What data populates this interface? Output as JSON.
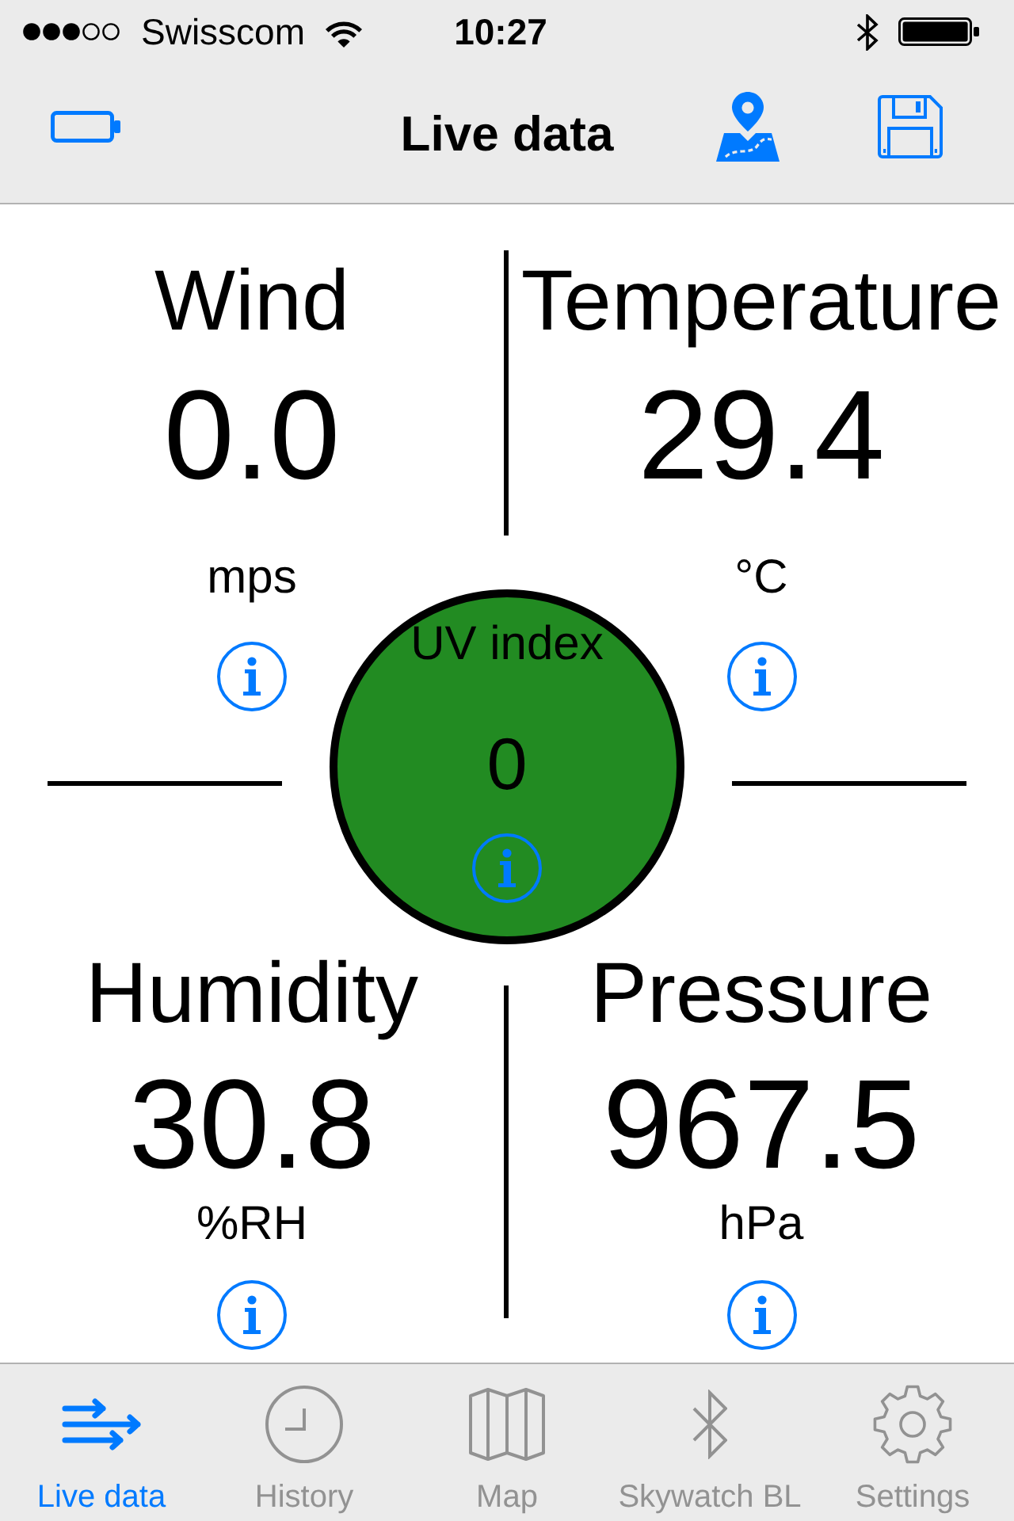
{
  "status_bar": {
    "carrier": "Swisscom",
    "time": "10:27"
  },
  "nav_bar": {
    "title": "Live data"
  },
  "readings": [
    {
      "label": "Wind",
      "value": "0.0",
      "unit": "mps"
    },
    {
      "label": "Temperature",
      "value": "29.4",
      "unit": "°C"
    },
    {
      "label": "Humidity",
      "value": "30.8",
      "unit": "%RH"
    },
    {
      "label": "Pressure",
      "value": "967.5",
      "unit": "hPa"
    }
  ],
  "uv_index": {
    "label": "UV index",
    "value": "0"
  },
  "tabs": [
    {
      "label": "Live data",
      "selected": true
    },
    {
      "label": "History",
      "selected": false
    },
    {
      "label": "Map",
      "selected": false
    },
    {
      "label": "Skywatch BL",
      "selected": false
    },
    {
      "label": "Settings",
      "selected": false
    }
  ]
}
